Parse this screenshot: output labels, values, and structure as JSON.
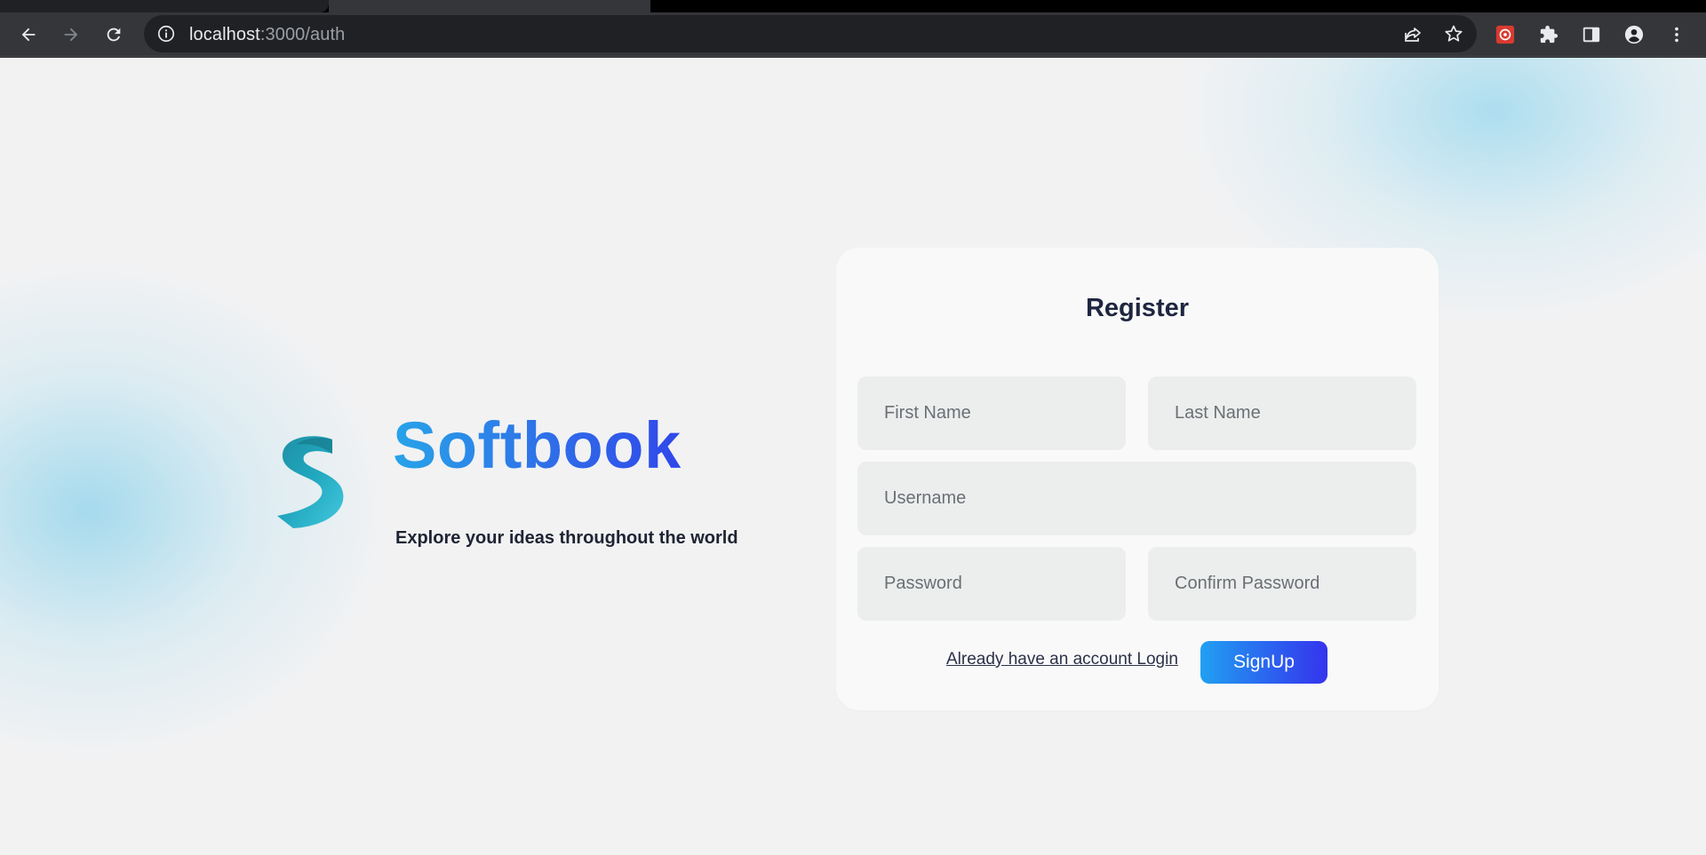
{
  "browser": {
    "url_host": "localhost",
    "url_rest": ":3000/auth"
  },
  "brand": {
    "name": "Softbook",
    "tagline": "Explore your ideas throughout the world",
    "logo_letter": "S",
    "gradient_start": "#27a4e8",
    "gradient_end": "#3047ea"
  },
  "register_form": {
    "title": "Register",
    "first_name_placeholder": "First Name",
    "last_name_placeholder": "Last Name",
    "username_placeholder": "Username",
    "password_placeholder": "Password",
    "confirm_password_placeholder": "Confirm Password",
    "login_link_label": "Already have an account Login",
    "signup_label": "SignUp"
  },
  "icons": {
    "back": "arrow-left-icon",
    "forward": "arrow-right-icon",
    "reload": "reload-icon",
    "info": "info-icon",
    "share": "share-icon",
    "bookmark": "star-icon",
    "extension_red": "extension-app-icon",
    "extensions": "puzzle-icon",
    "side_panel": "side-panel-icon",
    "profile": "profile-icon",
    "menu": "kebab-menu-icon"
  }
}
